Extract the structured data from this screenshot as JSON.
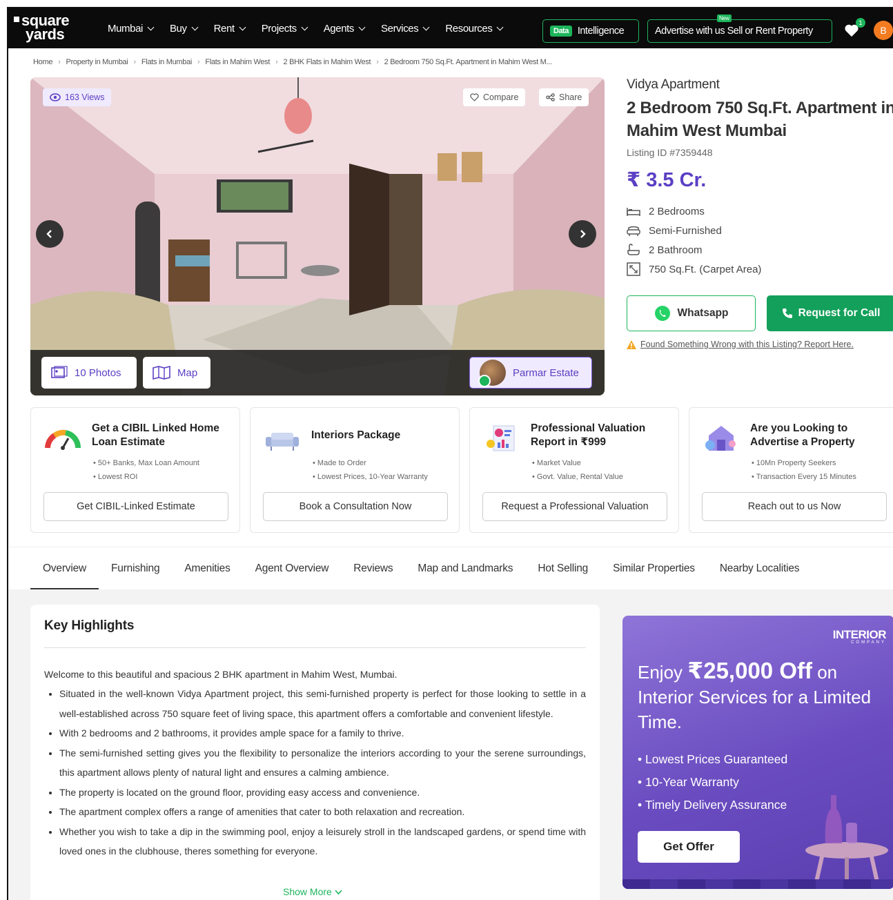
{
  "header": {
    "logo_line1": "square",
    "logo_line2": "yards",
    "nav": [
      "Mumbai",
      "Buy",
      "Rent",
      "Projects",
      "Agents",
      "Services",
      "Resources"
    ],
    "data_tag": "Data",
    "intelligence": "Intelligence",
    "advertise": "Advertise with us Sell or Rent Property",
    "new_tag": "New",
    "wishlist_count": "1",
    "avatar_initial": "B"
  },
  "breadcrumbs": [
    "Home",
    "Property in Mumbai",
    "Flats in Mumbai",
    "Flats in Mahim West",
    "2 BHK Flats in Mahim West",
    "2 Bedroom 750 Sq.Ft. Apartment in Mahim West M..."
  ],
  "gallery": {
    "views": "163 Views",
    "compare": "Compare",
    "share": "Share",
    "photos": "10 Photos",
    "map": "Map",
    "agent": "Parmar Estate"
  },
  "property": {
    "project": "Vidya Apartment",
    "title": "2 Bedroom 750 Sq.Ft. Apartment in Mahim West Mumbai",
    "listing_id": "Listing ID #7359448",
    "price": "₹ 3.5 Cr.",
    "features": [
      "2 Bedrooms",
      "Semi-Furnished",
      "2 Bathroom",
      "750 Sq.Ft. (Carpet Area)"
    ],
    "whatsapp": "Whatsapp",
    "request_call": "Request for Call",
    "report": "Found Something Wrong with this Listing? Report Here."
  },
  "cards": [
    {
      "title": "Get a CIBIL Linked Home Loan Estimate",
      "bullets": [
        "50+ Banks, Max Loan Amount",
        "Lowest ROI"
      ],
      "button": "Get CIBIL-Linked Estimate"
    },
    {
      "title": "Interiors Package",
      "bullets": [
        "Made to Order",
        "Lowest Prices, 10-Year Warranty"
      ],
      "button": "Book a Consultation Now"
    },
    {
      "title": "Professional Valuation Report in ₹999",
      "bullets": [
        "Market Value",
        "Govt. Value, Rental Value"
      ],
      "button": "Request a Professional Valuation"
    },
    {
      "title": "Are you Looking to Advertise a Property",
      "bullets": [
        "10Mn Property Seekers",
        "Transaction Every 15 Minutes"
      ],
      "button": "Reach out to us Now"
    }
  ],
  "tabs": [
    "Overview",
    "Furnishing",
    "Amenities",
    "Agent Overview",
    "Reviews",
    "Map and Landmarks",
    "Hot Selling",
    "Similar Properties",
    "Nearby Localities"
  ],
  "highlights": {
    "heading": "Key Highlights",
    "intro": "Welcome to this beautiful and spacious 2 BHK apartment in Mahim West, Mumbai.",
    "points": [
      "Situated in the well-known Vidya Apartment project, this semi-furnished property is perfect for those looking to settle in a well-established across 750 square feet of living space, this apartment offers a comfortable and convenient lifestyle.",
      "With 2 bedrooms and 2 bathrooms, it provides ample space for a family to thrive.",
      "The semi-furnished setting gives you the flexibility to personalize the interiors according to your the serene surroundings, this apartment allows plenty of natural light and ensures a calming ambience.",
      "The property is located on the ground floor, providing easy access and convenience.",
      "The apartment complex offers a range of amenities that cater to both relaxation and recreation.",
      "Whether you wish to take a dip in the swimming pool, enjoy a leisurely stroll in the landscaped gardens, or spend time with loved ones in the clubhouse, theres something for everyone."
    ],
    "show_more": "Show More"
  },
  "promo": {
    "brand": "INTERIOR",
    "brand_sub": "COMPANY",
    "enjoy": "Enjoy ",
    "amount": "₹25,000 Off",
    "rest": " on Interior Services for a Limited Time.",
    "bullets": [
      "Lowest Prices Guaranteed",
      "10-Year Warranty",
      "Timely Delivery Assurance"
    ],
    "button": "Get Offer"
  },
  "colors": {
    "brand_green": "#1db55c",
    "price_purple": "#5b3fc4",
    "nav_bg": "#0b0b0b"
  }
}
